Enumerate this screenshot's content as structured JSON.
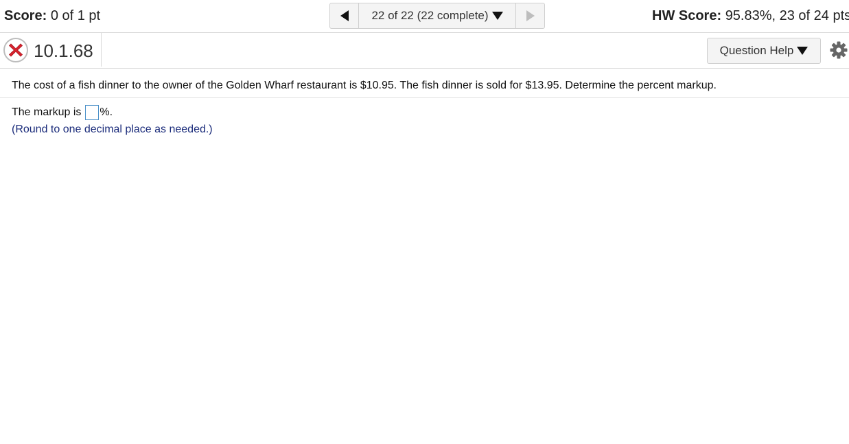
{
  "header": {
    "score_label": "Score:",
    "score_value": "0 of 1 pt",
    "nav_position": "22 of 22 (22 complete)",
    "hw_score_label": "HW Score:",
    "hw_score_value": "95.83%, 23 of 24 pts"
  },
  "question_bar": {
    "status_icon": "incorrect-x-icon",
    "question_number": "10.1.68",
    "help_label": "Question Help",
    "settings_icon": "gear-icon"
  },
  "question": {
    "text": "The cost of a fish dinner to the owner of the Golden Wharf restaurant is $10.95. The fish dinner is sold for $13.95. Determine the percent markup.",
    "answer_prefix": "The markup is",
    "answer_value": "",
    "answer_suffix": "%.",
    "hint": "(Round to one decimal place as needed.)"
  },
  "colors": {
    "incorrect_red": "#d9232e",
    "hint_text": "#1a2b7a",
    "input_border": "#4a90c8"
  }
}
